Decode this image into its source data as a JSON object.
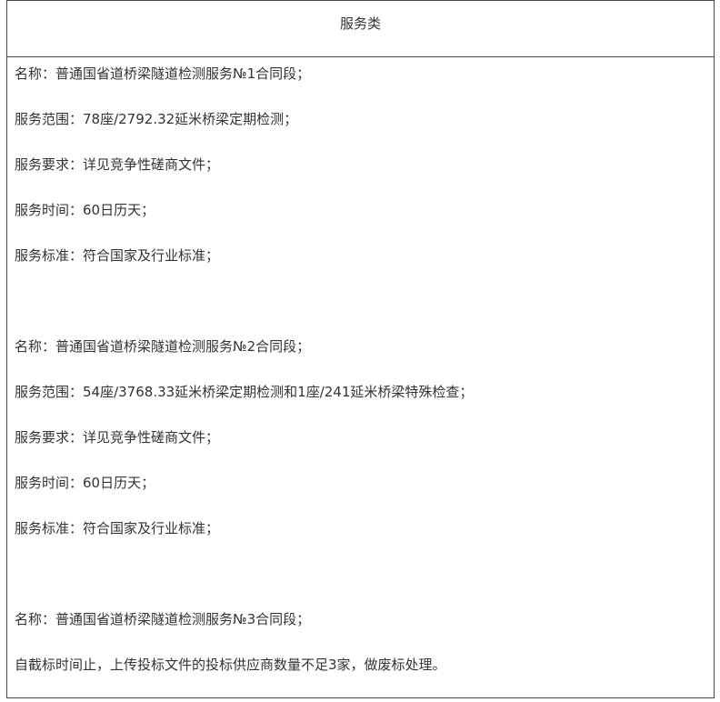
{
  "header": {
    "title": "服务类"
  },
  "sections": [
    {
      "lines": [
        "名称：普通国省道桥梁隧道检测服务№1合同段；",
        "服务范围：78座/2792.32延米桥梁定期检测；",
        "服务要求：详见竞争性磋商文件；",
        "服务时间：60日历天；",
        "服务标准：符合国家及行业标准；"
      ]
    },
    {
      "lines": [
        "名称：普通国省道桥梁隧道检测服务№2合同段；",
        "服务范围：54座/3768.33延米桥梁定期检测和1座/241延米桥梁特殊检查；",
        "服务要求：详见竞争性磋商文件；",
        "服务时间：60日历天；",
        "服务标准：符合国家及行业标准；"
      ]
    },
    {
      "lines": [
        "名称：普通国省道桥梁隧道检测服务№3合同段；",
        "自截标时间止，上传投标文件的投标供应商数量不足3家，做废标处理。"
      ]
    }
  ]
}
